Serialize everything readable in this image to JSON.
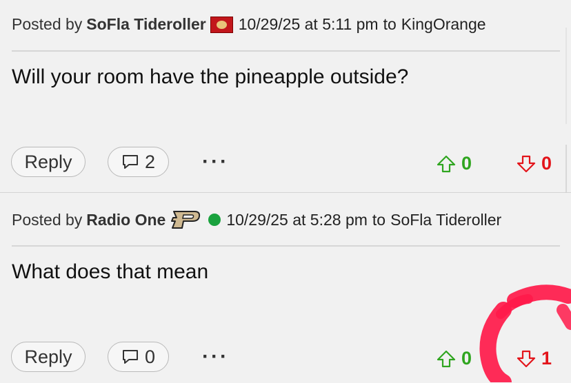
{
  "posts": [
    {
      "posted_by_label": "Posted by",
      "author": "SoFla Tideroller",
      "timestamp": "10/29/25 at 5:11 pm",
      "to_label": "to",
      "recipient": "KingOrange",
      "body": "Will your room have the pineapple outside?",
      "reply_label": "Reply",
      "comment_count": "2",
      "more_label": "···",
      "upvotes": "0",
      "downvotes": "0"
    },
    {
      "posted_by_label": "Posted by",
      "author": "Radio One",
      "timestamp": "10/29/25 at 5:28 pm",
      "to_label": "to",
      "recipient": "SoFla Tideroller",
      "body": "What does that mean",
      "reply_label": "Reply",
      "comment_count": "0",
      "more_label": "···",
      "upvotes": "0",
      "downvotes": "1"
    }
  ],
  "colors": {
    "upvote": "#2fa51f",
    "downvote": "#e3141a",
    "online": "#1aa23e",
    "annotation": "#ff1744"
  },
  "icons": {
    "post1_badge": "alabama-flag-icon",
    "post2_badge": "purdue-p-logo-icon",
    "post2_status": "online-dot-icon",
    "comment": "speech-bubble-icon",
    "upvote": "arrow-up-icon",
    "downvote": "arrow-down-icon"
  }
}
